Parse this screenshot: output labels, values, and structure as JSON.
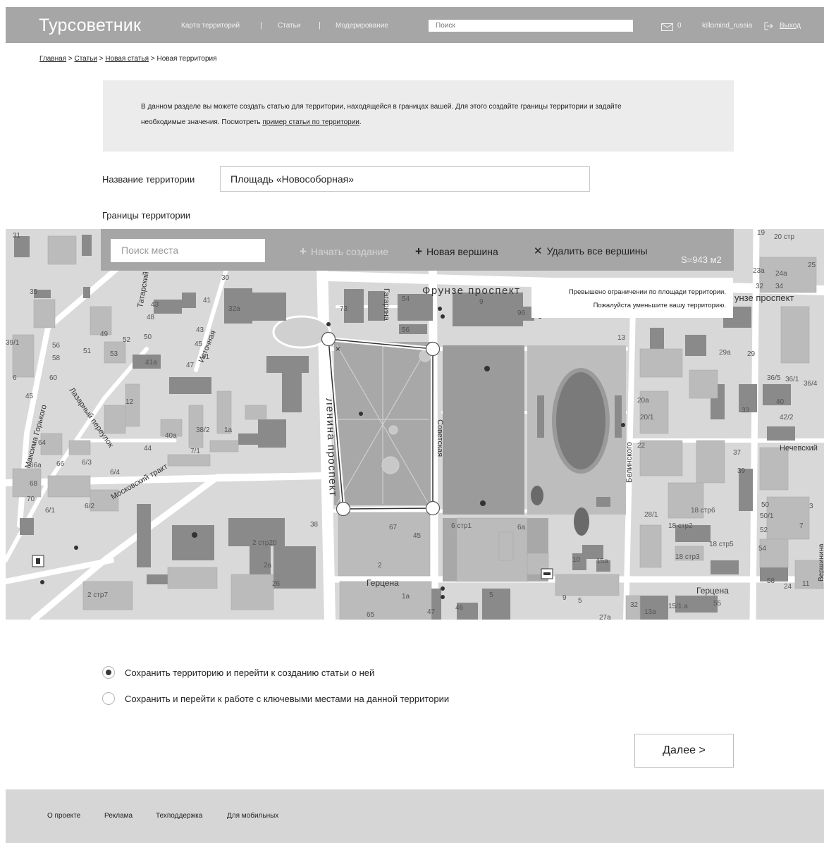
{
  "header": {
    "logo": "Турсоветник",
    "nav": [
      "Карта территорий",
      "Статьи",
      "Модерирование"
    ],
    "separator": "|",
    "search_placeholder": "Поиск",
    "message_count": "0",
    "username": "killomind_russia",
    "logout": "Выход"
  },
  "breadcrumb": {
    "items": [
      "Главная",
      "Статьи",
      "Новая статья"
    ],
    "current": "Новая территория",
    "separator": ">"
  },
  "info": {
    "text_line1": "В данном разделе вы можете создать статью для территории, находящейся в границах вашей. Для этого создайте границы территории и задайте",
    "text_line2": "необходимые значения. Посмотреть ",
    "link": "пример статьи по территории",
    "text_end": "."
  },
  "form": {
    "name_label": "Название территории",
    "name_value": "Площадь «Новособорная»",
    "bounds_label": "Границы территории"
  },
  "map_toolbar": {
    "search_placeholder": "Поиск места",
    "start": "Начать создание",
    "new_vertex": "Новая вершина",
    "delete_all": "Удалить все вершины",
    "plus": "+",
    "cross": "✕",
    "area": "S=943 м2"
  },
  "warning": {
    "line1": "Превышено ограничении по площади территории.",
    "line2": "Пожалуйста уменьшите вашу территорию."
  },
  "map_labels": {
    "street1": "Фрунзе проспект",
    "street2": "Ленина проспект",
    "street3": "Советская",
    "street4": "Московский тракт",
    "street5": "Герцена",
    "street6": "Источная",
    "street7": "Гагарина",
    "street8": "Белинского",
    "street9": "Нечевский",
    "street10": "Татарский",
    "street11": "Лазарный переулок",
    "street12": "Максима Горького",
    "street13": "Вершинина",
    "street14": "унзе проспект",
    "n9": "9",
    "n96": "96",
    "n13": "13",
    "n41a": "41а",
    "n43": "43",
    "n38": "38",
    "n2ctr20": "2 стр20",
    "n2a": "2а",
    "n67": "67",
    "n45": "45",
    "n2": "2",
    "n6ctr1": "6 стр1",
    "n6a": "6а",
    "n10": "10",
    "n15a": "15а",
    "n18ctr6": "18 стр6",
    "n18ctr3": "18 стр3",
    "n40": "40",
    "n42_2": "42/2",
    "n37": "37",
    "n39": "39",
    "n50": "50",
    "n26": "26",
    "n65": "65",
    "n47": "47",
    "n46": "46",
    "n5": "5",
    "n55": "55",
    "n58": "58",
    "n24": "24",
    "n11": "11",
    "n3": "3",
    "n2ctr7": "2 стр7",
    "n41": "41",
    "n44": "44",
    "n12": "12",
    "n40a": "40а",
    "n38_2": "38/2",
    "n1a": "1а",
    "n7_1": "7/1",
    "n6_3": "6/3",
    "n6_4": "6/4",
    "n68": "68",
    "n70": "70",
    "n6_1": "6/1",
    "n6_2": "6/2",
    "n66a": "66а",
    "n66": "66",
    "n64": "64",
    "n20a": "20а",
    "n20_1": "20/1",
    "n22": "22",
    "n28_1": "28/1",
    "n18ctr2": "18 стр2",
    "n18ctr5": "18 стр5",
    "n54": "54",
    "n52": "52",
    "n7": "7",
    "n50_1": "50/1",
    "n36_5": "36/5",
    "n36_1": "36/1",
    "n36_4": "36/4",
    "n29a": "29а",
    "n29": "29",
    "n19": "19",
    "n20ctr": "20 стр",
    "n25": "25",
    "n23a": "23а",
    "n24a": "24а",
    "n34": "34",
    "n32": "32",
    "n31": "31",
    "n35": "35",
    "n1a_b": "1а",
    "n27a": "27а",
    "n15_1a": "15/1 а",
    "n5b": "5",
    "n9b": "9",
    "n32b": "32",
    "n33": "33",
    "n13a": "13а",
    "n56": "56",
    "n54b": "54",
    "n73": "73",
    "n48": "48",
    "n30": "30",
    "n32a": "32а",
    "n43b": "43",
    "n45b": "45",
    "n47b": "47",
    "n39_1": "39/1",
    "n56b": "56",
    "n58b": "58",
    "n60": "60",
    "n64b": "64",
    "n45c": "45",
    "n49": "49",
    "n51": "51",
    "n53": "53",
    "n52b": "52",
    "n50b": "50",
    "n41b": "41",
    "n6": "6"
  },
  "options": {
    "opt1": "Сохранить территорию и перейти к созданию статьи о ней",
    "opt2": "Сохранить и перейти к работе с ключевыми местами на данной территории",
    "selected": 0
  },
  "next_button": "Далее >",
  "footer": [
    "О проекте",
    "Реклама",
    "Техподдержка",
    "Для мобильных"
  ]
}
